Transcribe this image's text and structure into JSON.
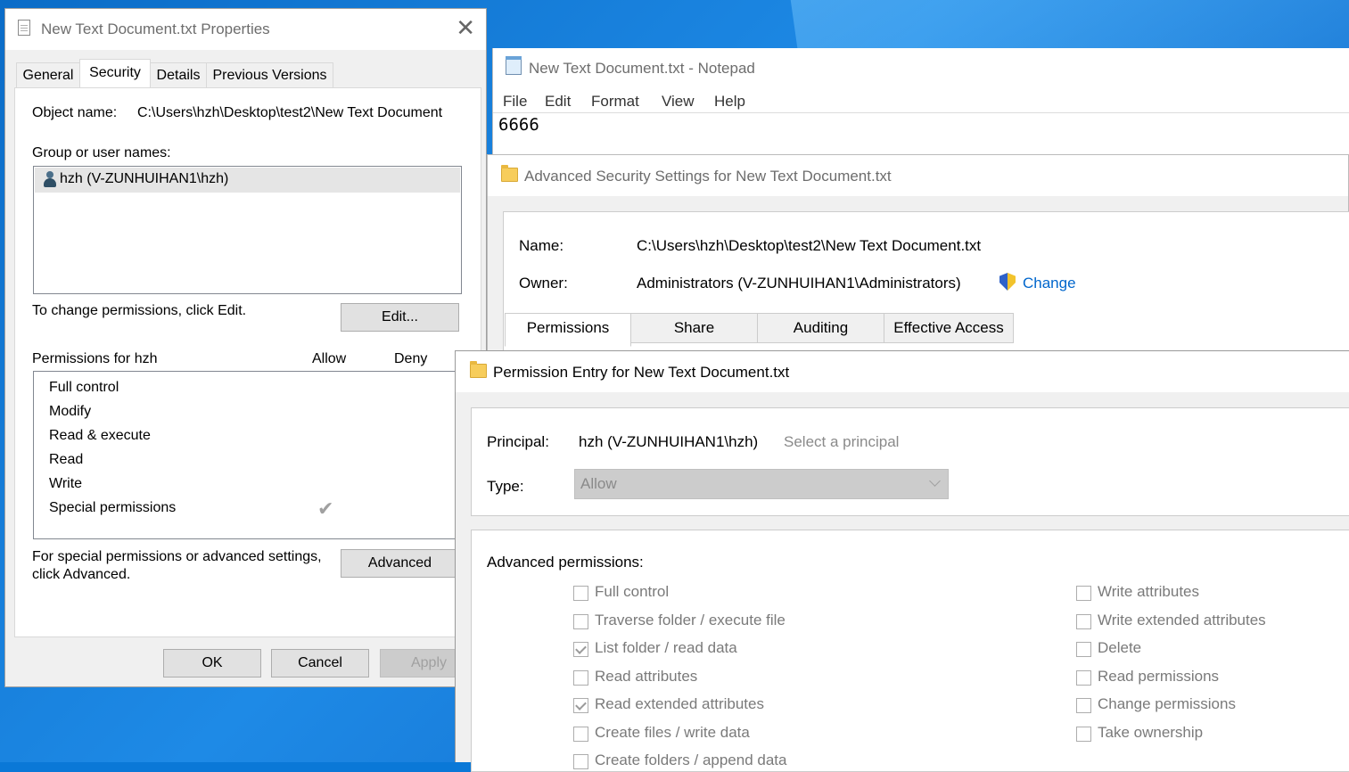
{
  "properties": {
    "title": "New Text Document.txt Properties",
    "tabs": [
      "General",
      "Security",
      "Details",
      "Previous Versions"
    ],
    "object_label": "Object name:",
    "object_value": "C:\\Users\\hzh\\Desktop\\test2\\New Text Document",
    "group_label": "Group or user names:",
    "user": "hzh (V-ZUNHUIHAN1\\hzh)",
    "change_text": "To change permissions, click Edit.",
    "edit_button": "Edit...",
    "perms_for": "Permissions for hzh",
    "allow_header": "Allow",
    "deny_header": "Deny",
    "permissions": [
      "Full control",
      "Modify",
      "Read & execute",
      "Read",
      "Write",
      "Special permissions"
    ],
    "special_line1": "For special permissions or advanced settings,",
    "special_line2": "click Advanced.",
    "advanced_button": "Advanced",
    "ok": "OK",
    "cancel": "Cancel",
    "apply": "Apply",
    "close_glyph": "✕",
    "check_glyph": "✔"
  },
  "notepad": {
    "title": "New Text Document.txt - Notepad",
    "menu": [
      "File",
      "Edit",
      "Format",
      "View",
      "Help"
    ],
    "content": "6666"
  },
  "advanced_security": {
    "title": "Advanced Security Settings for New Text Document.txt",
    "name_label": "Name:",
    "name_value": "C:\\Users\\hzh\\Desktop\\test2\\New Text Document.txt",
    "owner_label": "Owner:",
    "owner_value": "Administrators (V-ZUNHUIHAN1\\Administrators)",
    "change_link": "Change",
    "tabs": [
      "Permissions",
      "Share",
      "Auditing",
      "Effective Access"
    ]
  },
  "permission_entry": {
    "title": "Permission Entry for New Text Document.txt",
    "principal_label": "Principal:",
    "principal_value": "hzh (V-ZUNHUIHAN1\\hzh)",
    "select_principal": "Select a principal",
    "type_label": "Type:",
    "type_value": "Allow",
    "adv_label": "Advanced permissions:",
    "left": [
      {
        "label": "Full control",
        "checked": false
      },
      {
        "label": "Traverse folder / execute file",
        "checked": false
      },
      {
        "label": "List folder / read data",
        "checked": true
      },
      {
        "label": "Read attributes",
        "checked": false
      },
      {
        "label": "Read extended attributes",
        "checked": true
      },
      {
        "label": "Create files / write data",
        "checked": false
      },
      {
        "label": "Create folders / append data",
        "checked": false
      }
    ],
    "right": [
      {
        "label": "Write attributes",
        "checked": false
      },
      {
        "label": "Write extended attributes",
        "checked": false
      },
      {
        "label": "Delete",
        "checked": false
      },
      {
        "label": "Read permissions",
        "checked": false
      },
      {
        "label": "Change permissions",
        "checked": false
      },
      {
        "label": "Take ownership",
        "checked": false
      }
    ]
  },
  "colors": {
    "link": "#0066cc",
    "desktop": "#0a78d7"
  }
}
